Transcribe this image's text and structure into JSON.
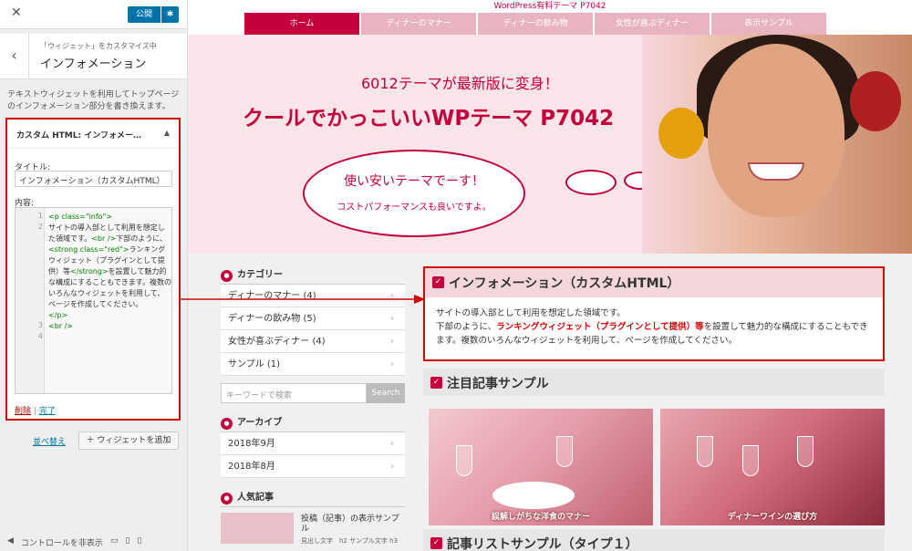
{
  "customizer": {
    "close_icon": "close-icon",
    "publish_label": "公開",
    "breadcrumb": "「ウィジェット」をカスタマイズ中",
    "panel_title": "インフォメーション",
    "description": "テキストウィジェットを利用してトップページのインフォメーション部分を書き換えます。",
    "widget_title": "カスタム HTML: インフォメー…",
    "title_label": "タイトル:",
    "title_value": "インフォメーション（カスタムHTML）",
    "content_label": "内容:",
    "code_lines": [
      "1",
      "2",
      "3",
      "4"
    ],
    "code": {
      "l1_tag": "<p class=\"info\">",
      "l1_text": "サイトの導入部として利用を想定した領域です。",
      "l1_br": "<br />",
      "l1_text2": "下部のように、",
      "l1_strong": "<strong class=\"red\">",
      "l1_text3": "ランキングウィジェット（プラグインとして提供）等",
      "l1_strong_end": "</strong>",
      "l1_text4": "を設置して魅力的な構成にすることもできます。複数のいろんなウィジェットを利用して、ページを作成してください。",
      "l3": "</p>",
      "l4": "<br />"
    },
    "delete_label": "削除",
    "separator": "|",
    "done_label": "完了",
    "reorder_label": "並べ替え",
    "add_widget_label": "ウィジェットを追加",
    "hide_controls_label": "コントロールを非表示"
  },
  "site": {
    "top_bar": "WordPress有料テーマ P7042",
    "nav": [
      {
        "label": "ホーム"
      },
      {
        "label": "ディナーのマナー"
      },
      {
        "label": "ディナーの飲み物"
      },
      {
        "label": "女性が喜ぶディナー"
      },
      {
        "label": "表示サンプル"
      }
    ],
    "hero_sub": "6012テーマが最新版に変身！",
    "hero_main": "クールでかっこいいWPテーマ P7042",
    "bubble_1": "使い安いテーマでーす！",
    "bubble_2": "コストパフォーマンスも良いですよ。",
    "sidebar": {
      "cat_heading": "カテゴリー",
      "categories": [
        {
          "label": "ディナーのマナー (4)"
        },
        {
          "label": "ディナーの飲み物 (5)"
        },
        {
          "label": "女性が喜ぶディナー (4)"
        },
        {
          "label": "サンプル (1)"
        }
      ],
      "search_placeholder": "キーワードで検索",
      "search_button": "Search",
      "archive_heading": "アーカイブ",
      "archives": [
        {
          "label": "2018年9月"
        },
        {
          "label": "2018年8月"
        }
      ],
      "popular_heading": "人気記事",
      "popular_title": "投稿（記事）の表示サンプル",
      "popular_excerpt": "見出し文字　h2 サンプル文字 h3"
    },
    "info_title": "インフォメーション（カスタムHTML）",
    "info_text_1": "サイトの導入部として利用を想定した領域です。",
    "info_text_2a": "下部のように、",
    "info_text_2b": "ランキングウィジェット（プラグインとして提供）等",
    "info_text_2c": "を設置して魅力的な構成にすることもできます。複数のいろんなウィジェットを利用して、ページを作成してください。",
    "featured_title": "注目記事サンプル",
    "thumb_1": "誤解しがちな洋食のマナー",
    "thumb_2": "ディナーワインの選び方",
    "list_title": "記事リストサンプル（タイプ１）"
  }
}
